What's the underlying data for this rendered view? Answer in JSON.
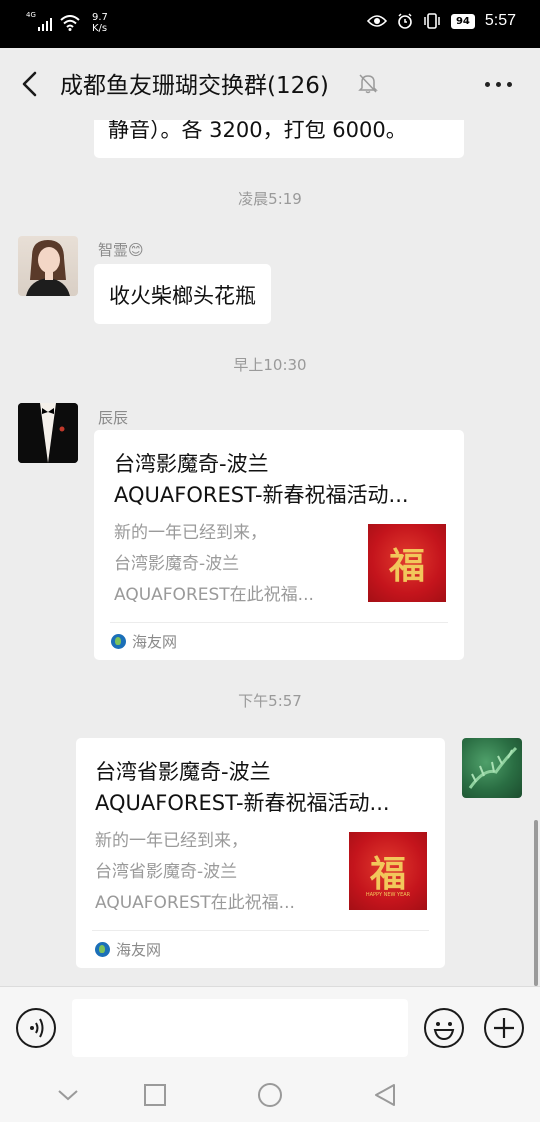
{
  "status_bar": {
    "network": "4G",
    "speed_value": "9.7",
    "speed_unit": "K/s",
    "battery": "94",
    "time": "5:57"
  },
  "header": {
    "title": "成都鱼友珊瑚交换群(126)"
  },
  "messages": [
    {
      "type": "text_partial",
      "text": "静音）。各 3200，打包 6000。"
    },
    {
      "type": "time",
      "text": "凌晨5:19"
    },
    {
      "type": "text",
      "sender": "智霊",
      "text": "收火柴榔头花瓶"
    },
    {
      "type": "time",
      "text": "早上10:30"
    },
    {
      "type": "card",
      "sender": "辰辰",
      "title_line1": "台湾影魔奇-波兰",
      "title_line2": "AQUAFOREST-新春祝福活动...",
      "desc_line1": "新的一年已经到来，",
      "desc_line2": "台湾影魔奇-波兰",
      "desc_line3": "AQUAFOREST在此祝福...",
      "thumb_char": "福",
      "source": "海友网"
    },
    {
      "type": "time",
      "text": "下午5:57"
    },
    {
      "type": "card",
      "sender": "self",
      "title_line1": "台湾省影魔奇-波兰",
      "title_line2": "AQUAFOREST-新春祝福活动...",
      "desc_line1": "新的一年已经到来，",
      "desc_line2": "台湾省影魔奇-波兰",
      "desc_line3": "AQUAFOREST在此祝福...",
      "thumb_char": "福",
      "thumb_caption": "HAPPY NEW YEAR",
      "source": "海友网"
    }
  ],
  "nick_emoji": "😊",
  "colors": {
    "chat_bg": "#ededed",
    "bubble": "#ffffff",
    "thumb_red": "#c4141c",
    "thumb_gold": "#f2c75b"
  },
  "icons": {
    "back": "chevron-left-icon",
    "mute": "bell-off-icon",
    "more": "more-dots-icon",
    "voice": "voice-icon",
    "emoji": "smiley-icon",
    "add": "plus-icon",
    "nav_down": "chevron-down-icon",
    "nav_home": "home-circle-icon",
    "nav_recent": "square-icon",
    "nav_back": "triangle-back-icon"
  }
}
